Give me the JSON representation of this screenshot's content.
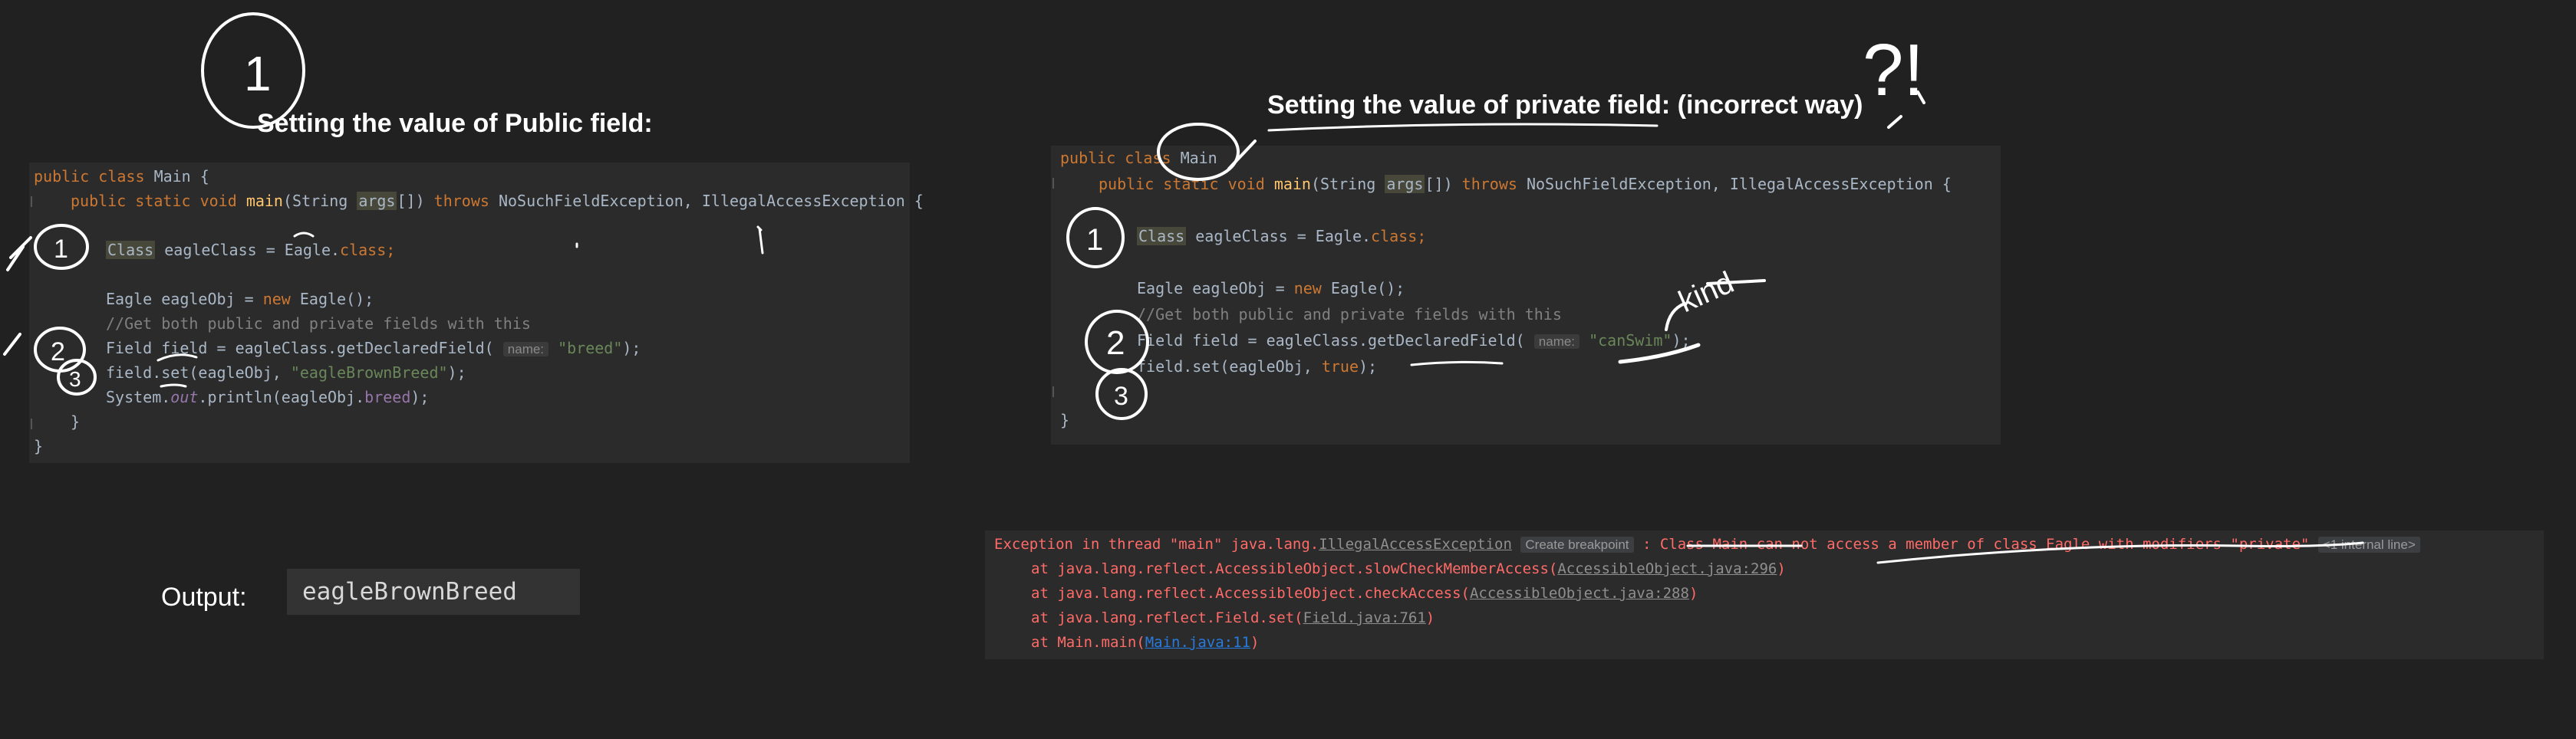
{
  "left": {
    "heading": "Setting the value of Public field:",
    "code": {
      "l1_public": "public",
      "l1_class": "class",
      "l1_name": "Main {",
      "l2_public": "public",
      "l2_static": "static",
      "l2_void": "void",
      "l2_main": "main",
      "l2_params_open": "(String ",
      "l2_args": "args",
      "l2_params_close": "[]) ",
      "l2_throws": "throws",
      "l2_exceptions": "NoSuchFieldException, IllegalAccessException {",
      "l3_class": "Class",
      "l3_rest": " eagleClass = Eagle.",
      "l3_classkw": "class",
      "l3_semi": ";",
      "l4_a": "Eagle eagleObj = ",
      "l4_new": "new",
      "l4_b": " Eagle();",
      "l5_comment": "//Get both public and private fields with this",
      "l6_a": "Field field = eagleClass.getDeclaredField(",
      "l6_hint": "name:",
      "l6_str": "\"breed\"",
      "l6_b": ");",
      "l7_a": "field.set(eagleObj, ",
      "l7_str": "\"eagleBrownBreed\"",
      "l7_b": ");",
      "l8_a": "System.",
      "l8_out": "out",
      "l8_b": ".println(eagleObj.",
      "l8_breed": "breed",
      "l8_c": ");",
      "close_inner": "}",
      "close_outer": "}"
    },
    "output_label": "Output:",
    "output_value": "eagleBrownBreed"
  },
  "right": {
    "heading": "Setting the value of private field: (incorrect way)",
    "code": {
      "l1_public": "public",
      "l1_class": "class",
      "l1_name": "Main",
      "l2_public": "public",
      "l2_static": "static",
      "l2_void": "void",
      "l2_main": "main",
      "l2_params_open": "(String ",
      "l2_args": "args",
      "l2_params_close": "[]) ",
      "l2_throws": "throws",
      "l2_exceptions": "NoSuchFieldException, IllegalAccessException {",
      "l3_class": "Class",
      "l3_rest": " eagleClass = Eagle.",
      "l3_classkw": "class",
      "l3_semi": ";",
      "l4_a": "Eagle eagleObj = ",
      "l4_new": "new",
      "l4_b": " Eagle();",
      "l5_comment": "//Get both public and private fields with this",
      "l6_a": "Field field = eagleClass.getDeclaredField(",
      "l6_hint": "name:",
      "l6_str": "\"canSwim\"",
      "l6_b": ");",
      "l7_a": "field.set(eagleObj, ",
      "l7_true": "true",
      "l7_b": ");",
      "close_outer": "}"
    },
    "console": {
      "l1_prefix": "Exception in thread \"main\" java.lang.",
      "l1_exception": "IllegalAccessException",
      "l1_breakpoint": "Create breakpoint",
      "l1_colon": " : ",
      "l1_message": "Class Main can not access a member of class Eagle with modifiers \"private\"",
      "l1_internal": "<1 internal line>",
      "l2_text": "at java.lang.reflect.AccessibleObject.slowCheckMemberAccess(",
      "l2_link": "AccessibleObject.java:296",
      "l2_close": ")",
      "l3_text": "at java.lang.reflect.AccessibleObject.checkAccess(",
      "l3_link": "AccessibleObject.java:288",
      "l3_close": ")",
      "l4_text": "at java.lang.reflect.Field.set(",
      "l4_link": "Field.java:761",
      "l4_close": ")",
      "l5_text": "at Main.main(",
      "l5_link": "Main.java:11",
      "l5_close": ")"
    }
  },
  "annotations": {
    "left_top": "1",
    "left_step1": "1",
    "left_step2": "2",
    "left_step3": "3",
    "right_top": "?!",
    "right_step1": "1",
    "right_step2": "2",
    "right_step3": "3",
    "right_note": "kind"
  },
  "colors": {
    "background": "#212121",
    "editor": "#2b2b2b",
    "keyword": "#cc7832",
    "method": "#ffc66d",
    "string": "#6a8759",
    "comment": "#808080",
    "field": "#9876aa",
    "error": "#ff6b68",
    "link": "#287bde"
  }
}
